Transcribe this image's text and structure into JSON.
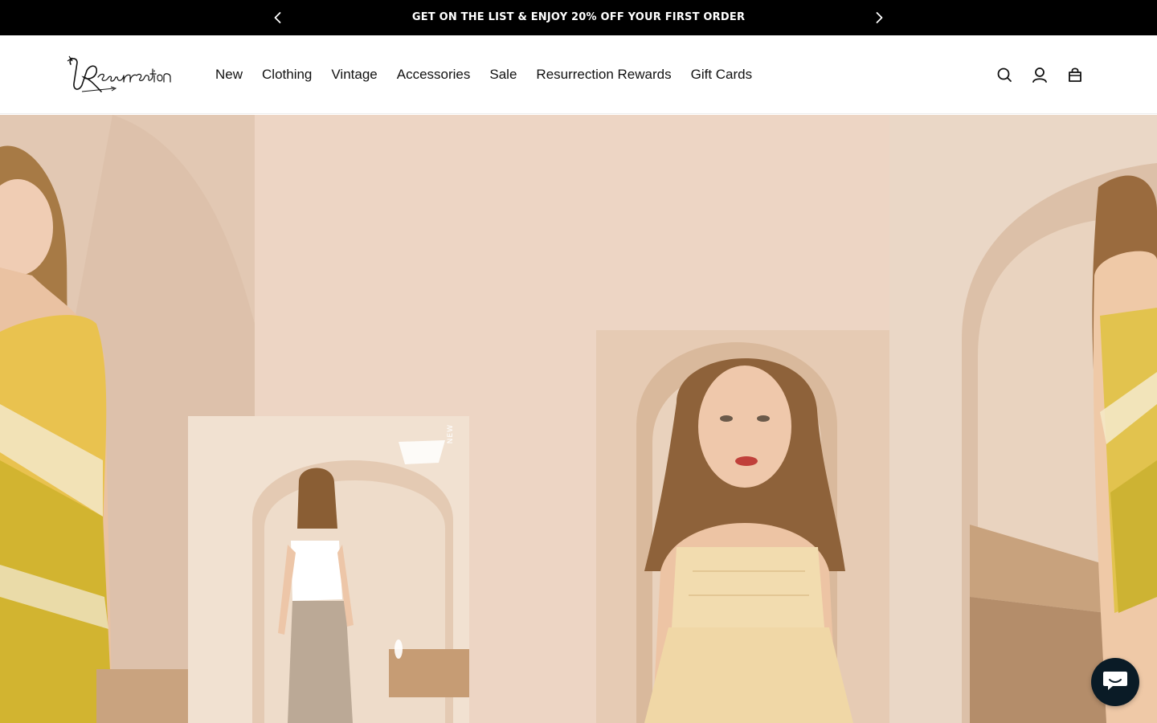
{
  "announcement": {
    "text": "GET ON THE LIST & ENJOY 20% OFF YOUR FIRST ORDER",
    "prev_icon": "chevron-left-icon",
    "next_icon": "chevron-right-icon"
  },
  "header": {
    "logo_text": "Resurrection",
    "nav": [
      {
        "label": "New"
      },
      {
        "label": "Clothing"
      },
      {
        "label": "Vintage"
      },
      {
        "label": "Accessories"
      },
      {
        "label": "Sale"
      },
      {
        "label": "Resurrection Rewards"
      },
      {
        "label": "Gift Cards"
      }
    ],
    "tools": [
      "search-icon",
      "account-icon",
      "cart-icon"
    ]
  },
  "hero": {
    "tag": "NEW"
  },
  "chat": {
    "icon": "chat-icon"
  },
  "colors": {
    "announcement_bg": "#000000",
    "announcement_text": "#ffffff",
    "hero_bg": "#edd5c4",
    "chat_bg": "#0a1b26"
  }
}
